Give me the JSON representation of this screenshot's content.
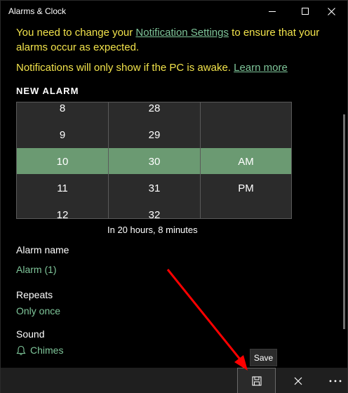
{
  "window": {
    "title": "Alarms & Clock"
  },
  "notice": {
    "line1_prefix": "You need to change your ",
    "line1_link": "Notification Settings",
    "line1_suffix": " to ensure that your alarms occur as expected.",
    "line2_prefix": "Notifications will only show if the PC is awake. ",
    "line2_link": "Learn more"
  },
  "new_alarm": {
    "heading": "NEW ALARM",
    "hours": [
      "8",
      "9",
      "10",
      "11",
      "12"
    ],
    "minutes": [
      "28",
      "29",
      "30",
      "31",
      "32"
    ],
    "periods": [
      "AM",
      "PM"
    ],
    "selected": {
      "hour": "10",
      "minute": "30",
      "period": "AM"
    },
    "time_until": "In 20 hours, 8 minutes"
  },
  "alarm_name": {
    "label": "Alarm name",
    "value": "Alarm (1)"
  },
  "repeats": {
    "label": "Repeats",
    "value": "Only once"
  },
  "sound": {
    "label": "Sound",
    "value": "Chimes",
    "icon": "bell-icon"
  },
  "command_bar": {
    "save_tooltip": "Save",
    "save_icon": "save-icon",
    "cancel_icon": "close-icon",
    "more_icon": "more-icon"
  },
  "colors": {
    "accent": "#7fc69a",
    "warning": "#f2e34b",
    "selection": "#6b9a72",
    "annotation_arrow": "#ff0000"
  }
}
